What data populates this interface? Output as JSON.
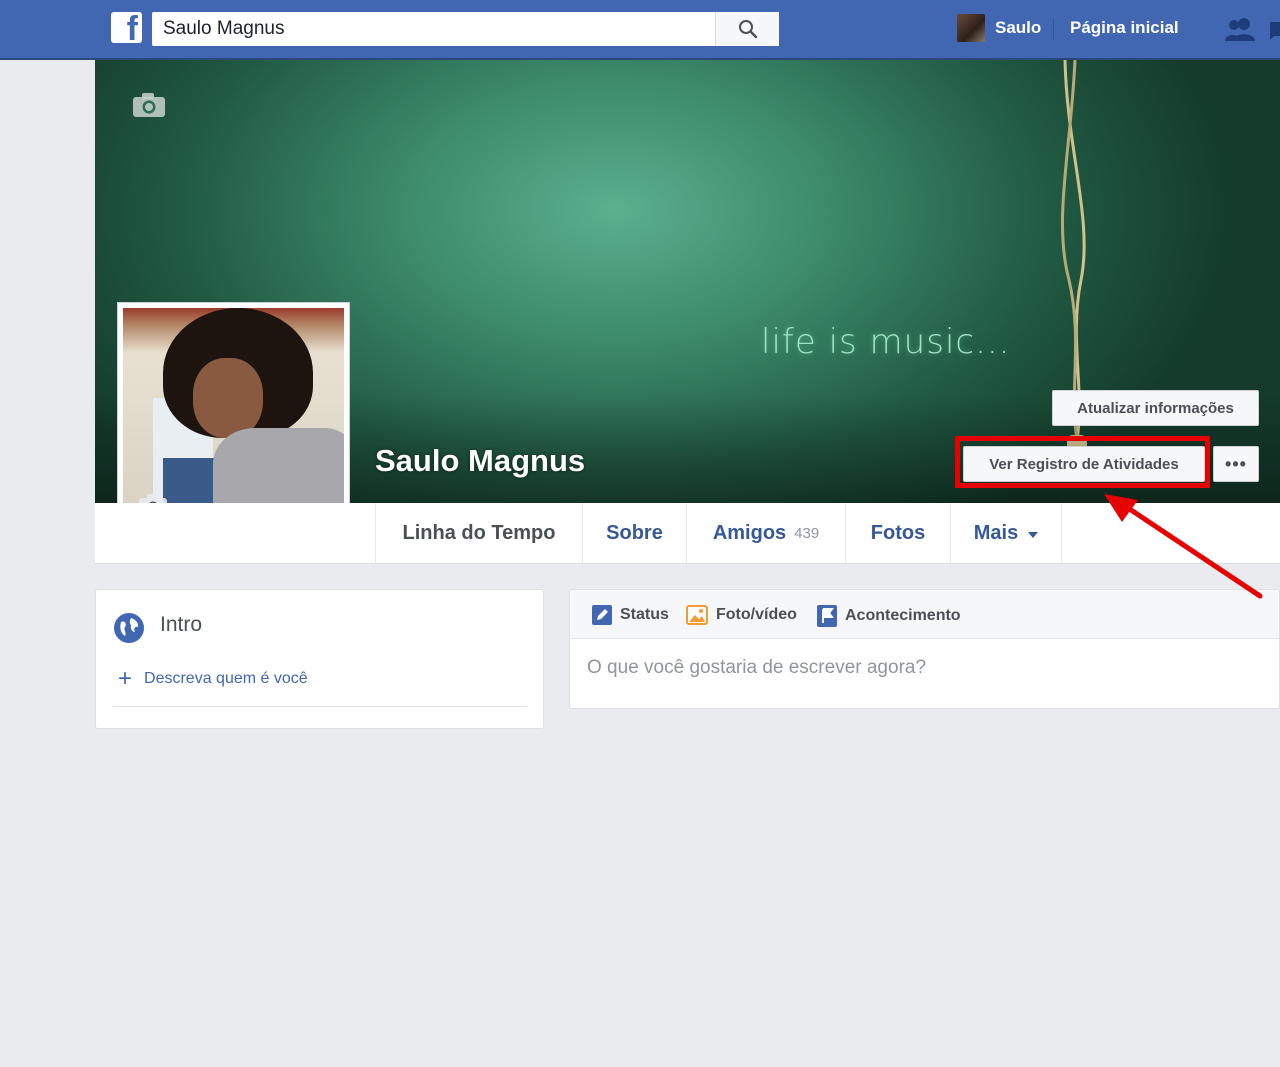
{
  "topbar": {
    "logo": "f",
    "search_value": "Saulo Magnus",
    "user_name": "Saulo",
    "home_label": "Página inicial"
  },
  "cover": {
    "overlay_text": "life is music...",
    "profile_name": "Saulo Magnus",
    "update_info_label": "Atualizar informações",
    "activity_log_label": "Ver Registro de Atividades",
    "more_label": "•••"
  },
  "nav": {
    "tabs": [
      {
        "label": "Linha do Tempo"
      },
      {
        "label": "Sobre"
      },
      {
        "label": "Amigos",
        "count": "439"
      },
      {
        "label": "Fotos"
      },
      {
        "label": "Mais"
      }
    ]
  },
  "intro": {
    "title": "Intro",
    "add_link": "Descreva quem é você"
  },
  "composer": {
    "tabs": [
      {
        "label": "Status"
      },
      {
        "label": "Foto/vídeo"
      },
      {
        "label": "Acontecimento"
      }
    ],
    "placeholder": "O que você gostaria de escrever agora?"
  },
  "colors": {
    "brand": "#4267b2",
    "link": "#365899",
    "highlight": "#e60000"
  }
}
